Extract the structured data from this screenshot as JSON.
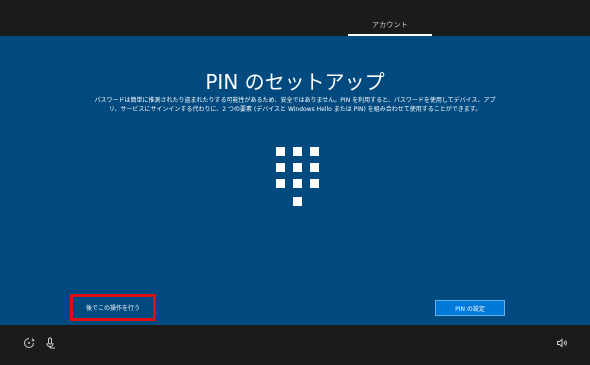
{
  "header": {
    "step_label": "アカウント"
  },
  "main": {
    "title": "PIN のセットアップ",
    "description": "パスワードは簡単に推測されたり盗まれたりする可能性があるため、安全ではありません。PIN を利用すると、パスワードを使用してデバイス、アプリ、サービスにサインインする代わりに、2 つの要素 (デバイスと Windows Hello または PIN) を組み合わせて使用することができます。",
    "keypad_icon": "pin-keypad-icon"
  },
  "actions": {
    "later_label": "後でこの操作を行う",
    "setup_pin_label": "PIN の設定"
  },
  "footer": {
    "icons": [
      "ease-of-access-icon",
      "microphone-icon",
      "volume-icon"
    ]
  },
  "colors": {
    "background": "#004a7f",
    "bar": "#1b1b1b",
    "primary_button": "#0078d7",
    "highlight_border": "#e01010"
  }
}
